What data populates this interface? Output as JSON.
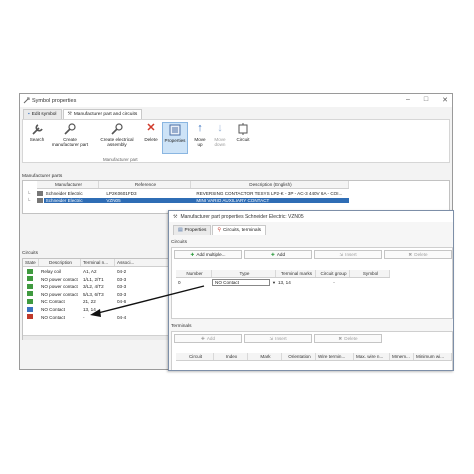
{
  "window": {
    "title": "Symbol properties",
    "tabs": [
      {
        "label": "Edit symbol"
      },
      {
        "label": "Manufacturer part and circuits"
      }
    ]
  },
  "ribbon": {
    "buttons": [
      {
        "label": "Search",
        "icon": "wrench-icon"
      },
      {
        "label": "Create manufacturer part",
        "icon": "wrench-gear-icon"
      },
      {
        "label": "Create electrical assembly",
        "icon": "wrench-gear-icon"
      },
      {
        "label": "Delete",
        "icon": "delete-x-icon"
      },
      {
        "label": "Properties",
        "icon": "properties-icon"
      },
      {
        "label": "Move up",
        "icon": "arrow-up-icon"
      },
      {
        "label": "Move down",
        "icon": "arrow-down-icon"
      },
      {
        "label": "Circuit",
        "icon": "circuit-icon"
      }
    ],
    "group_label": "Manufacturer part"
  },
  "manufacturer_parts": {
    "section_label": "Manufacturer parts",
    "columns": [
      "Manufacturer",
      "Reference",
      "Description (English)"
    ],
    "rows": [
      {
        "manufacturer": "Schneider Electric",
        "reference": "LP2K0601FD3",
        "description": "REVERSING CONTACTOR TESYS LP2-K - 3P - AC-3 440V 6A - COI..."
      },
      {
        "manufacturer": "Schneider Electric",
        "reference": "VZN05",
        "description": "MINI VARIO AUXILIARY CONTACT"
      }
    ]
  },
  "circuits_list": {
    "section_label": "Circuits",
    "columns": [
      "State",
      "Description",
      "Terminal n...",
      "Associ..."
    ],
    "rows": [
      {
        "color": "#3f9a3f",
        "description": "Relay coil",
        "terminals": "A1, A2",
        "assoc": "04-2"
      },
      {
        "color": "#3f9a3f",
        "description": "NO power contact",
        "terminals": "1/L1, 2/T1",
        "assoc": "03-3"
      },
      {
        "color": "#3f9a3f",
        "description": "NO power contact",
        "terminals": "3/L2, 4/T2",
        "assoc": "03-3"
      },
      {
        "color": "#3f9a3f",
        "description": "NO power contact",
        "terminals": "5/L3, 6/T3",
        "assoc": "03-3"
      },
      {
        "color": "#3f9a3f",
        "description": "NC Contact",
        "terminals": "21, 22",
        "assoc": "04-6"
      },
      {
        "color": "#3a73c0",
        "description": "NO Contact",
        "terminals": "13, 14",
        "assoc": ""
      },
      {
        "color": "#c0392b",
        "description": "NO Contact",
        "terminals": "-",
        "assoc": "04-4"
      }
    ]
  },
  "dialog": {
    "title": "Manufacturer part properties Schneider Electric: VZN05",
    "tabs": [
      {
        "label": "Properties"
      },
      {
        "label": "Circuits, terminals"
      }
    ],
    "circuits": {
      "section_label": "Circuits",
      "add_multiple": "Add multiple...",
      "add": "Add",
      "insert": "Insert",
      "delete": "Delete",
      "columns": [
        "Number",
        "Type",
        "Terminal marks",
        "Circuit group",
        "Symbol"
      ],
      "row": {
        "number": "0",
        "type": "NO Contact",
        "terminals": "13, 14",
        "group": "-"
      }
    },
    "terminals": {
      "section_label": "Terminals",
      "add": "Add",
      "insert": "Insert",
      "delete": "Delete",
      "columns": [
        "Circuit",
        "Index",
        "Mark",
        "Orientation",
        "Wire termin...",
        "Max. wire n...",
        "Mmem...",
        "Minimum wi..."
      ]
    }
  }
}
